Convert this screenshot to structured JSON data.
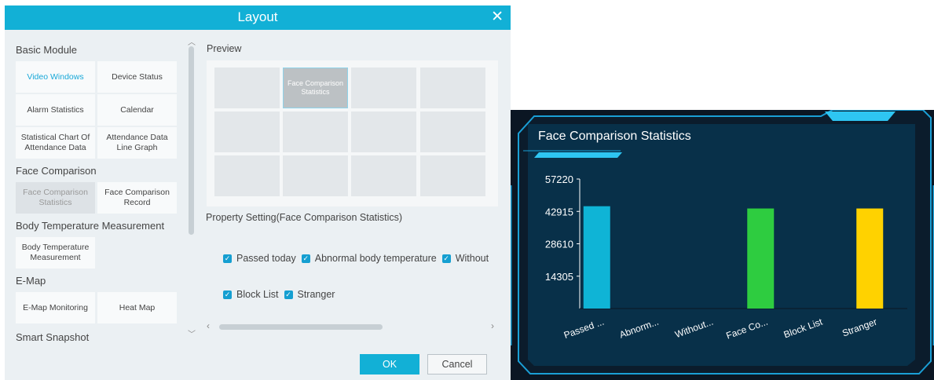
{
  "dialog": {
    "title": "Layout",
    "close_glyph": "✕",
    "categories": [
      {
        "name": "Basic Module",
        "modules": [
          "Video Windows",
          "Device Status",
          "Alarm Statistics",
          "Calendar",
          "Statistical Chart Of Attendance Data",
          "Attendance Data Line Graph"
        ]
      },
      {
        "name": "Face Comparison",
        "modules": [
          "Face Comparison Statistics",
          "Face Comparison Record"
        ]
      },
      {
        "name": "Body Temperature Measurement",
        "modules": [
          "Body Temperature Measurement"
        ]
      },
      {
        "name": "E-Map",
        "modules": [
          "E-Map Monitoring",
          "Heat Map"
        ]
      },
      {
        "name": "Smart Snapshot",
        "modules": []
      }
    ],
    "active_module": "Video Windows",
    "disabled_module": "Face Comparison Statistics",
    "preview_label": "Preview",
    "preview_selected_cell": "Face Comparison Statistics",
    "property_label": "Property Setting(Face Comparison Statistics)",
    "checkboxes_row1": [
      "Passed today",
      "Abnormal body temperature",
      "Without"
    ],
    "checkboxes_row2": [
      "Block List",
      "Stranger"
    ],
    "ok_label": "OK",
    "cancel_label": "Cancel",
    "icons": {
      "close": "close-icon",
      "check": "checkmark-icon",
      "scroll_up": "chevron-up-icon",
      "scroll_down": "chevron-down-icon"
    }
  },
  "chart_panel": {
    "title": "Face Comparison Statistics",
    "colors": {
      "background": "#0b1623",
      "plot_bg": "#08304a",
      "frame": "#1a9fd6",
      "accent": "#2ec5f2"
    }
  },
  "chart_data": {
    "type": "bar",
    "title": "Face Comparison Statistics",
    "categories": [
      "Passed ...",
      "Abnorm...",
      "Without...",
      "Face Co...",
      "Block List",
      "Stranger"
    ],
    "values": [
      45200,
      0,
      0,
      44200,
      0,
      44200
    ],
    "colors": [
      "#0fb4d6",
      "#0fb4d6",
      "#0fb4d6",
      "#2ecc40",
      "#0fb4d6",
      "#ffd200"
    ],
    "yticks": [
      "57220",
      "42915",
      "28610",
      "14305"
    ],
    "ylim": [
      0,
      57220
    ],
    "xlabel": "",
    "ylabel": ""
  }
}
